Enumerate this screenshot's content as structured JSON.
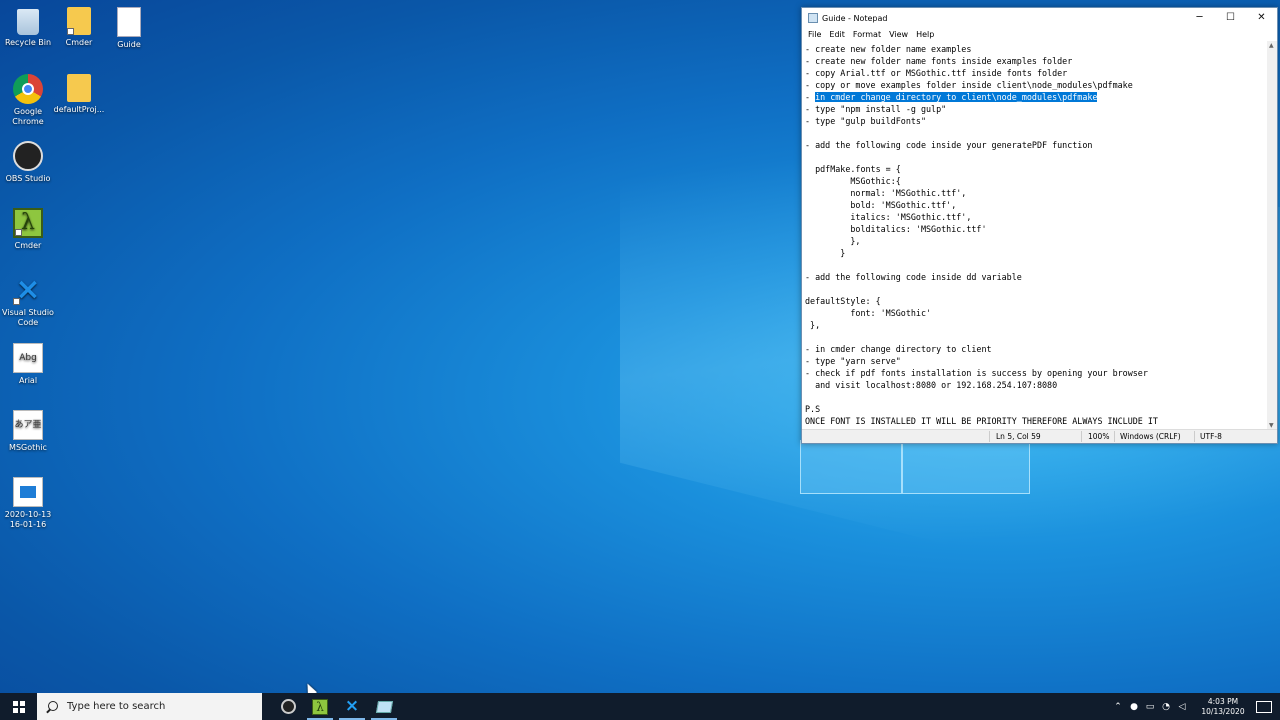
{
  "desktop": {
    "icons": [
      {
        "label": "Recycle Bin",
        "icon": "recycle-bin-icon"
      },
      {
        "label": "Cmder",
        "icon": "folder-icon"
      },
      {
        "label": "Guide",
        "icon": "text-document-icon"
      },
      {
        "label": "Google Chrome",
        "icon": "chrome-icon"
      },
      {
        "label": "defaultProj...",
        "icon": "folder-icon"
      },
      {
        "label": "OBS Studio",
        "icon": "obs-icon"
      },
      {
        "label": "Cmder",
        "icon": "cmder-icon"
      },
      {
        "label": "Visual Studio Code",
        "icon": "vscode-icon"
      },
      {
        "label": "Arial",
        "icon": "font-file-icon",
        "glyph": "Abg"
      },
      {
        "label": "MSGothic",
        "icon": "font-file-icon",
        "glyph": "あア亜"
      },
      {
        "label": "2020-10-13 16-01-16",
        "icon": "video-file-icon"
      }
    ]
  },
  "notepad": {
    "title": "Guide - Notepad",
    "controls": {
      "minimize": "─",
      "maximize": "☐",
      "close": "✕"
    },
    "menu": [
      "File",
      "Edit",
      "Format",
      "View",
      "Help"
    ],
    "lines": [
      "- create new folder name examples",
      "- create new folder name fonts inside examples folder",
      "- copy Arial.ttf or MSGothic.ttf inside fonts folder",
      "- copy or move examples folder inside client\\node_modules\\pdfmake",
      "- ",
      "- type \"npm install -g gulp\"",
      "- type \"gulp buildFonts\"",
      "",
      "- add the following code inside your generatePDF function",
      "",
      "  pdfMake.fonts = {",
      "         MSGothic:{",
      "         normal: 'MSGothic.ttf',",
      "         bold: 'MSGothic.ttf',",
      "         italics: 'MSGothic.ttf',",
      "         bolditalics: 'MSGothic.ttf'",
      "         },",
      "       }",
      "",
      "- add the following code inside dd variable",
      "",
      "defaultStyle: {",
      "         font: 'MSGothic'",
      " },",
      "",
      "- in cmder change directory to client",
      "- type \"yarn serve\"",
      "- check if pdf fonts installation is success by opening your browser",
      "  and visit localhost:8080 or 192.168.254.107:8080",
      "",
      "P.S",
      "ONCE FONT IS INSTALLED IT WILL BE PRIORITY THEREFORE ALWAYS INCLUDE IT"
    ],
    "selected_line_index": 4,
    "selected_text": "in cmder change directory to client\\node_modules\\pdfmake",
    "status": {
      "position": "Ln 5, Col 59",
      "zoom": "100%",
      "line_endings": "Windows (CRLF)",
      "encoding": "UTF-8"
    }
  },
  "taskbar": {
    "search_placeholder": "Type here to search",
    "apps": [
      "obs-icon",
      "cmder-icon",
      "vscode-icon",
      "notepad-icon"
    ],
    "clock_time": "4:03 PM",
    "clock_date": "10/13/2020"
  }
}
